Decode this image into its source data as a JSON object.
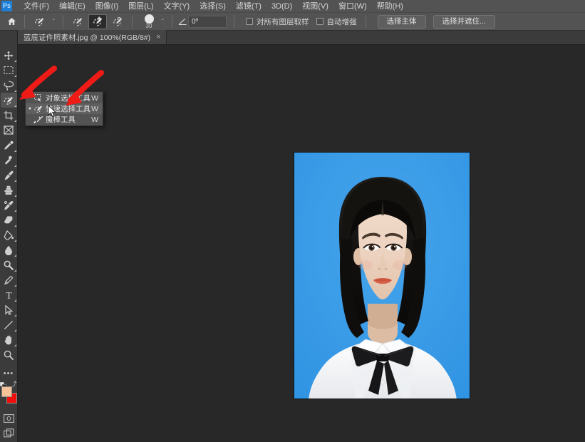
{
  "app": {
    "name": "Adobe Photoshop",
    "logo_text": "Ps",
    "accent_color": "#1f7fd4"
  },
  "menubar": {
    "items": [
      {
        "label": "文件(F)",
        "name": "menu-file"
      },
      {
        "label": "编辑(E)",
        "name": "menu-edit"
      },
      {
        "label": "图像(I)",
        "name": "menu-image"
      },
      {
        "label": "图层(L)",
        "name": "menu-layer"
      },
      {
        "label": "文字(Y)",
        "name": "menu-type"
      },
      {
        "label": "选择(S)",
        "name": "menu-select"
      },
      {
        "label": "滤镜(T)",
        "name": "menu-filter"
      },
      {
        "label": "3D(D)",
        "name": "menu-3d"
      },
      {
        "label": "视图(V)",
        "name": "menu-view"
      },
      {
        "label": "窗口(W)",
        "name": "menu-window"
      },
      {
        "label": "帮助(H)",
        "name": "menu-help"
      }
    ]
  },
  "optionsbar": {
    "home_icon": "home-icon",
    "tool_preset_icon": "quick-selection-preset-icon",
    "preset_chevron": "ˇ",
    "modes": [
      {
        "name": "selection-mode-new",
        "icon": "quick-select-new-icon",
        "active": false
      },
      {
        "name": "selection-mode-add",
        "icon": "quick-select-add-icon",
        "active": true
      },
      {
        "name": "selection-mode-subtract",
        "icon": "quick-select-subtract-icon",
        "active": false
      }
    ],
    "brush_size": "30",
    "brush_chevron": "ˇ",
    "angle_icon": "angle-icon",
    "angle_value": "0º",
    "checkbox_sample_all_layers": {
      "label": "对所有图层取样",
      "checked": false
    },
    "checkbox_auto_enhance": {
      "label": "自动增强",
      "checked": false
    },
    "button_select_subject": "选择主体",
    "button_select_and_mask": "选择并遮住..."
  },
  "tabbar": {
    "tabs": [
      {
        "label": "蓝底证件照素材.jpg @ 100%(RGB/8#)",
        "close_icon": "close-icon",
        "close_glyph": "×",
        "active": true
      }
    ]
  },
  "toolbar": {
    "tools": [
      {
        "name": "move-tool",
        "icon": "move-icon",
        "selected": false,
        "has_flyout": true
      },
      {
        "name": "rectangular-marquee-tool",
        "icon": "marquee-icon",
        "selected": false,
        "has_flyout": true
      },
      {
        "name": "lasso-tool",
        "icon": "lasso-icon",
        "selected": false,
        "has_flyout": true
      },
      {
        "name": "quick-selection-tool",
        "icon": "quick-selection-icon",
        "selected": true,
        "has_flyout": true
      },
      {
        "name": "crop-tool",
        "icon": "crop-icon",
        "selected": false,
        "has_flyout": true
      },
      {
        "name": "frame-tool",
        "icon": "frame-icon",
        "selected": false,
        "has_flyout": false
      },
      {
        "name": "eyedropper-tool",
        "icon": "eyedropper-icon",
        "selected": false,
        "has_flyout": true
      },
      {
        "name": "spot-healing-brush-tool",
        "icon": "healing-brush-icon",
        "selected": false,
        "has_flyout": true
      },
      {
        "name": "brush-tool",
        "icon": "brush-icon",
        "selected": false,
        "has_flyout": true
      },
      {
        "name": "clone-stamp-tool",
        "icon": "clone-stamp-icon",
        "selected": false,
        "has_flyout": true
      },
      {
        "name": "history-brush-tool",
        "icon": "history-brush-icon",
        "selected": false,
        "has_flyout": true
      },
      {
        "name": "eraser-tool",
        "icon": "eraser-icon",
        "selected": false,
        "has_flyout": true
      },
      {
        "name": "gradient-tool",
        "icon": "paint-bucket-icon",
        "selected": false,
        "has_flyout": true
      },
      {
        "name": "blur-tool",
        "icon": "blur-drop-icon",
        "selected": false,
        "has_flyout": true
      },
      {
        "name": "dodge-tool",
        "icon": "dodge-icon",
        "selected": false,
        "has_flyout": true
      },
      {
        "name": "pen-tool",
        "icon": "pen-icon",
        "selected": false,
        "has_flyout": true
      },
      {
        "name": "horizontal-type-tool",
        "icon": "type-icon",
        "selected": false,
        "has_flyout": true
      },
      {
        "name": "path-selection-tool",
        "icon": "path-selection-arrow-icon",
        "selected": false,
        "has_flyout": true
      },
      {
        "name": "line-tool",
        "icon": "line-shape-icon",
        "selected": false,
        "has_flyout": true
      },
      {
        "name": "hand-tool",
        "icon": "hand-icon",
        "selected": false,
        "has_flyout": true
      },
      {
        "name": "zoom-tool",
        "icon": "zoom-magnifier-icon",
        "selected": false,
        "has_flyout": false
      },
      {
        "name": "edit-toolbar-more",
        "icon": "ellipsis-icon",
        "selected": false,
        "has_flyout": false
      }
    ],
    "colors": {
      "foreground": "#f5c29a",
      "background": "#f20d0d",
      "swap_icon": "swap-colors-icon",
      "default_icon": "default-colors-icon"
    },
    "quick_mask": {
      "name": "quick-mask-toggle",
      "icon": "quick-mask-icon"
    },
    "screen_mode": {
      "name": "screen-mode-toggle",
      "icon": "screen-mode-icon"
    }
  },
  "flyout_menu": {
    "visible": true,
    "items": [
      {
        "name": "flyout-object-selection-tool",
        "icon": "object-selection-icon",
        "label": "对象选择工具",
        "shortcut": "W",
        "selected": false
      },
      {
        "name": "flyout-quick-selection-tool",
        "icon": "quick-selection-icon",
        "label": "快速选择工具",
        "shortcut": "W",
        "selected": true
      },
      {
        "name": "flyout-magic-wand-tool",
        "icon": "magic-wand-icon",
        "label": "魔棒工具",
        "shortcut": "W",
        "selected": false
      }
    ],
    "selected_bullet": "●"
  },
  "canvas": {
    "background_color": "#282828",
    "document": {
      "name": "id-photo-image",
      "background_color": "#3a9ce8",
      "description": "蓝底证件照",
      "zoom": "100%"
    }
  },
  "annotations": {
    "arrows": [
      {
        "name": "red-arrow-to-toolbar",
        "color": "#f01b16"
      },
      {
        "name": "red-arrow-to-quick-selection-item",
        "color": "#f01b16"
      }
    ],
    "cursor": {
      "name": "mouse-cursor",
      "icon": "arrow-cursor-icon"
    }
  }
}
